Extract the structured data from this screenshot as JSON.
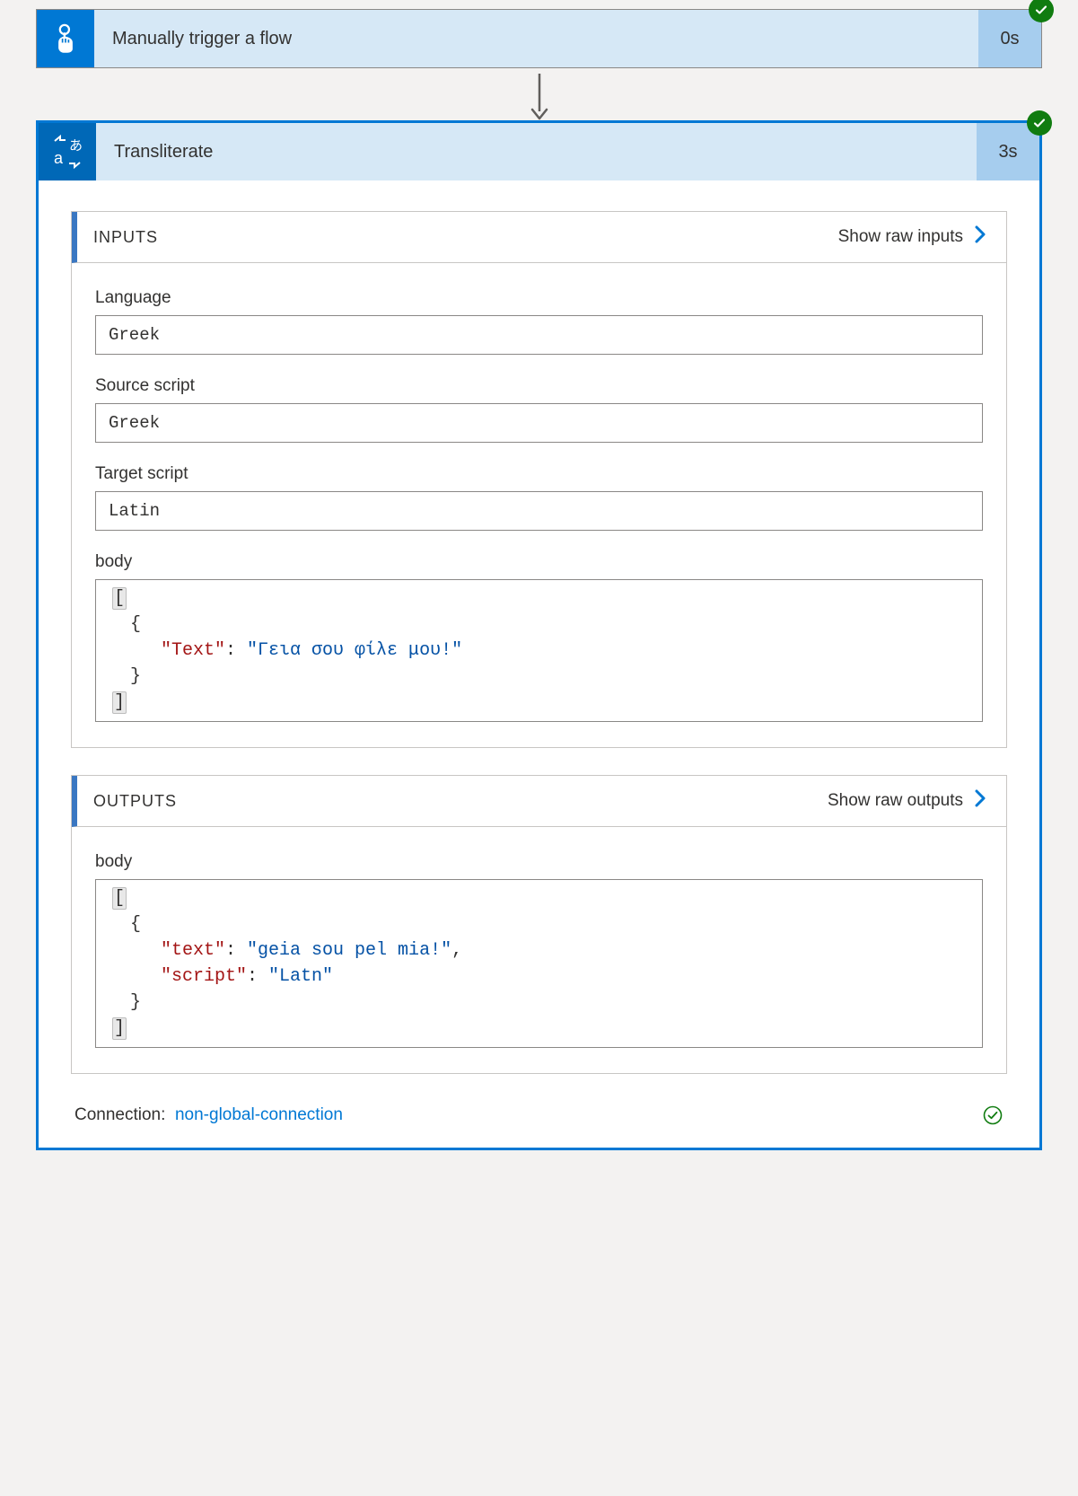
{
  "trigger": {
    "title": "Manually trigger a flow",
    "duration": "0s"
  },
  "action": {
    "title": "Transliterate",
    "duration": "3s"
  },
  "inputs": {
    "section_title": "INPUTS",
    "show_raw_label": "Show raw inputs",
    "fields": {
      "language": {
        "label": "Language",
        "value": "Greek"
      },
      "source_script": {
        "label": "Source script",
        "value": "Greek"
      },
      "target_script": {
        "label": "Target script",
        "value": "Latin"
      },
      "body": {
        "label": "body",
        "json_key": "\"Text\"",
        "json_value": "\"Γεια σου φίλε μου!\""
      }
    }
  },
  "outputs": {
    "section_title": "OUTPUTS",
    "show_raw_label": "Show raw outputs",
    "body": {
      "label": "body",
      "line1_key": "\"text\"",
      "line1_value": "\"geia sou pel mia!\"",
      "line2_key": "\"script\"",
      "line2_value": "\"Latn\""
    }
  },
  "connection": {
    "label": "Connection:",
    "name": "non-global-connection"
  }
}
